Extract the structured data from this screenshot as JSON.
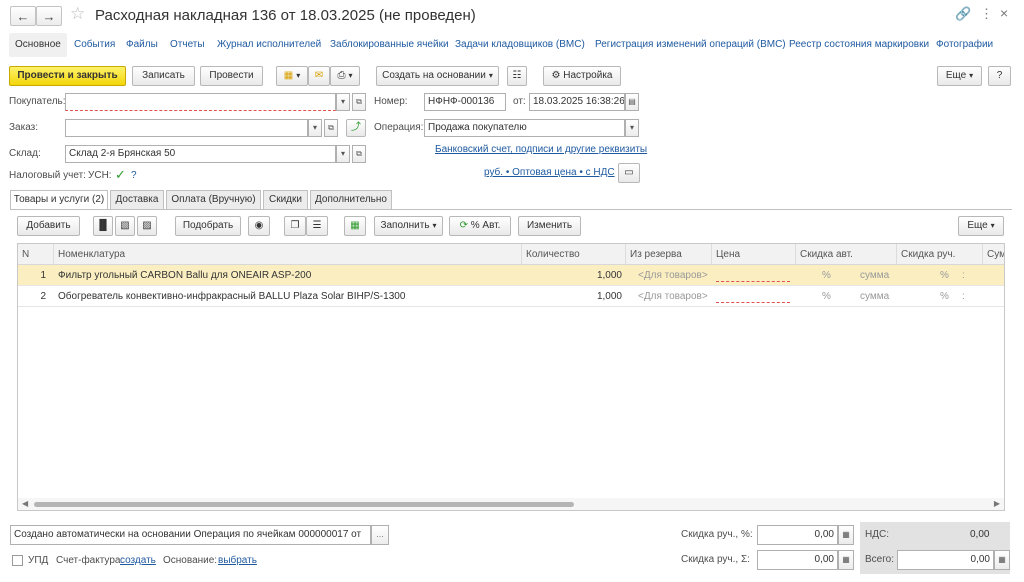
{
  "window": {
    "title": "Расходная накладная 136 от 18.03.2025 (не проведен)",
    "back_icon": "arrow-left-icon",
    "forward_icon": "arrow-right-icon",
    "star_icon": "star-icon",
    "link_icon": "link-icon",
    "more_icon": "more-vert-icon",
    "close_icon": "close-icon"
  },
  "tabs": [
    "Основное",
    "События",
    "Файлы",
    "Отчеты",
    "Журнал исполнителей",
    "Заблокированные ячейки",
    "Задачи кладовщиков (ВМС)",
    "Регистрация изменений операций (ВМС)",
    "Реестр состояния маркировки",
    "Фотографии"
  ],
  "toolbar": {
    "post_close": "Провести и закрыть",
    "save": "Записать",
    "post": "Провести",
    "create_based": "Создать на основании",
    "settings": "Настройка",
    "more": "Еще",
    "help": "?"
  },
  "form": {
    "buyer_label": "Покупатель:",
    "buyer_value": "",
    "number_label": "Номер:",
    "number_value": "НФНФ-000136",
    "date_label": "от:",
    "date_value": "18.03.2025 16:38:26",
    "order_label": "Заказ:",
    "order_value": "",
    "operation_label": "Операция:",
    "operation_value": "Продажа покупателю",
    "warehouse_label": "Склад:",
    "warehouse_value": "Склад 2-я Брянская 50",
    "bank_link": "Банковский счет, подписи и другие реквизиты",
    "tax_label": "Налоговый учет:",
    "tax_value": "УСН:",
    "tax_help": "?",
    "price_link": "руб. • Оптовая цена • с НДС"
  },
  "inner_tabs": [
    "Товары и услуги (2)",
    "Доставка",
    "Оплата (Вручную)",
    "Скидки",
    "Дополнительно"
  ],
  "table_toolbar": {
    "add": "Добавить",
    "pick": "Подобрать",
    "fill": "Заполнить",
    "auto_percent": "% Авт.",
    "change": "Изменить",
    "more": "Еще"
  },
  "table": {
    "columns": [
      "N",
      "Номенклатура",
      "Количество",
      "Из резерва",
      "Цена",
      "Скидка авт.",
      "Скидка руч.",
      "Сум"
    ],
    "rows": [
      {
        "n": "1",
        "name": "Фильтр угольный CARBON Ballu для ONEAIR ASP-200",
        "qty": "1,000",
        "reserve": "<Для товаров>",
        "price": "",
        "auto_pct": "%",
        "auto_sum": "сумма",
        "man_pct": "%",
        "man_x": ":"
      },
      {
        "n": "2",
        "name": "Обогреватель конвективно-инфракрасный BALLU Plaza Solar BIHP/S-1300",
        "qty": "1,000",
        "reserve": "<Для товаров>",
        "price": "",
        "auto_pct": "%",
        "auto_sum": "сумма",
        "man_pct": "%",
        "man_x": ":"
      }
    ]
  },
  "footer": {
    "comment": "Создано автоматически на основании Операция по ячейкам 000000017 от",
    "upd_label": "УПД",
    "invoice_label": "Счет-фактура:",
    "invoice_link": "создать",
    "basis_label": "Основание:",
    "basis_link": "выбрать",
    "disc_pct_label": "Скидка руч., %:",
    "disc_pct_value": "0,00",
    "disc_sum_label": "Скидка руч., Σ:",
    "disc_sum_value": "0,00",
    "vat_label": "НДС:",
    "vat_value": "0,00",
    "total_label": "Всего:",
    "total_value": "0,00"
  }
}
